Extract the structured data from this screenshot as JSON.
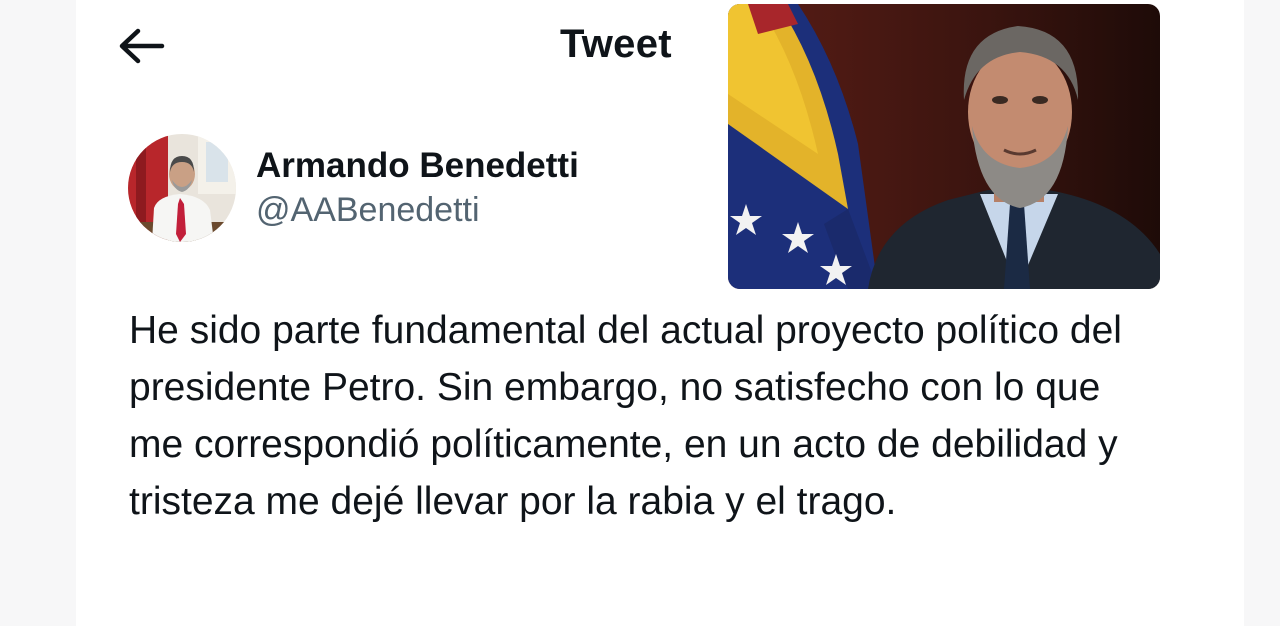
{
  "header": {
    "title": "Tweet",
    "back_icon": "arrow-left-icon"
  },
  "author": {
    "name": "Armando Benedetti",
    "handle": "@AABenedetti"
  },
  "tweet": {
    "text": "He sido parte fundamental del actual proyecto político del presidente Petro. Sin embargo, no satisfecho con lo que me correspondió políticamente, en un acto de debilidad y tristeza me dejé llevar por la rabia y el trago."
  },
  "colors": {
    "text_primary": "#0f1419",
    "text_secondary": "#536471",
    "background": "#ffffff"
  }
}
